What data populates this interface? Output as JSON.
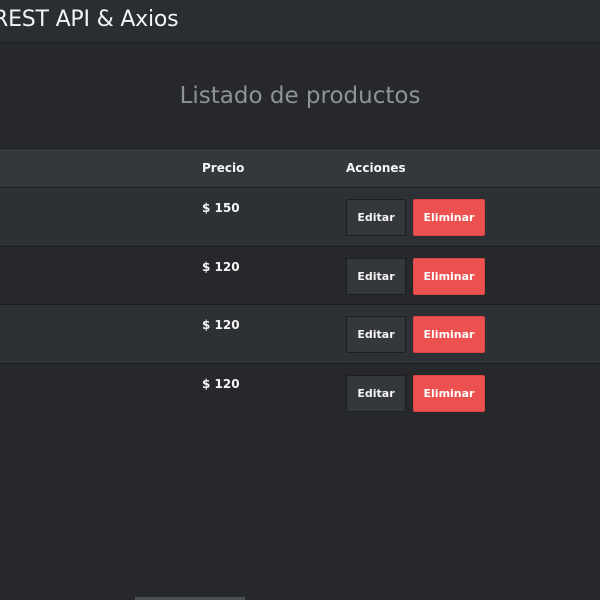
{
  "navbar": {
    "brand": "REST API & Axios"
  },
  "heading": "Listado de productos",
  "table": {
    "headers": {
      "price": "Precio",
      "actions": "Acciones"
    },
    "rows": [
      {
        "price": "$ 150",
        "edit_label": "Editar",
        "delete_label": "Eliminar"
      },
      {
        "price": "$ 120",
        "edit_label": "Editar",
        "delete_label": "Eliminar"
      },
      {
        "price": "$ 120",
        "edit_label": "Editar",
        "delete_label": "Eliminar"
      },
      {
        "price": "$ 120",
        "edit_label": "Editar",
        "delete_label": "Eliminar"
      }
    ]
  },
  "colors": {
    "background": "#26282c",
    "navbar": "#2a2d31",
    "table_header": "#34373b",
    "danger": "#ec5150"
  }
}
